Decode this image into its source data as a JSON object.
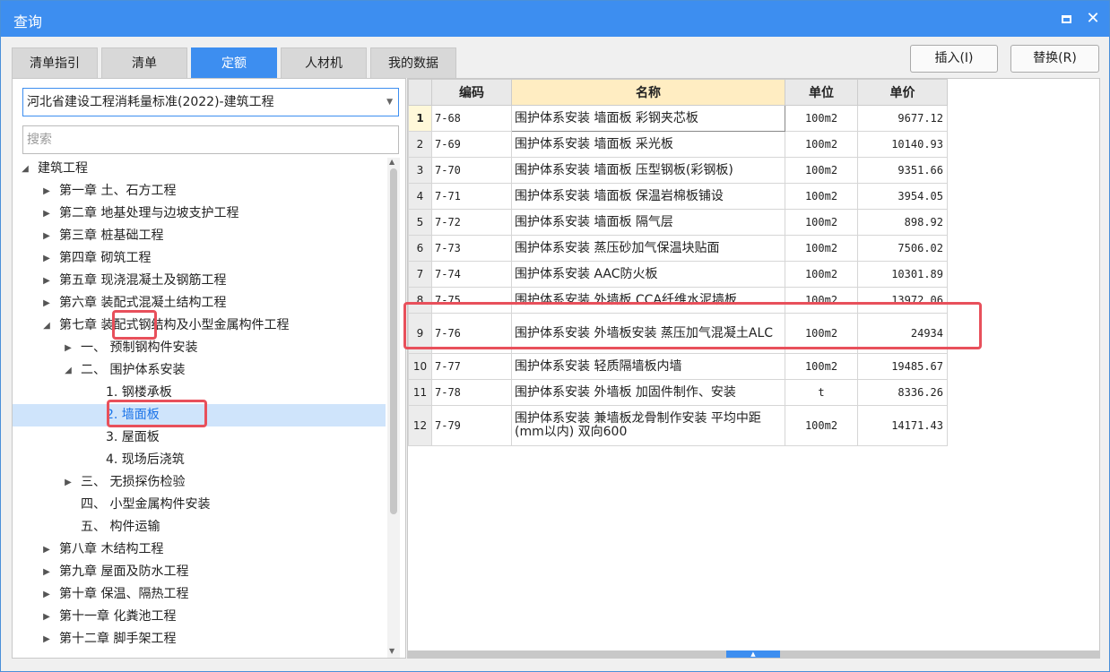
{
  "window": {
    "title": "查询"
  },
  "tabs": [
    {
      "label": "清单指引"
    },
    {
      "label": "清单"
    },
    {
      "label": "定额"
    },
    {
      "label": "人材机"
    },
    {
      "label": "我的数据"
    }
  ],
  "buttons": {
    "insert": "插入(I)",
    "replace": "替换(R)"
  },
  "left": {
    "standard": "河北省建设工程消耗量标准(2022)-建筑工程",
    "search_placeholder": "搜索",
    "tree": [
      {
        "label": "建筑工程",
        "expander": "expanded"
      },
      {
        "label": "第一章 土、石方工程",
        "expander": "collapsed"
      },
      {
        "label": "第二章 地基处理与边坡支护工程",
        "expander": "collapsed"
      },
      {
        "label": "第三章 桩基础工程",
        "expander": "collapsed"
      },
      {
        "label": "第四章 砌筑工程",
        "expander": "collapsed"
      },
      {
        "label": "第五章 现浇混凝土及钢筋工程",
        "expander": "collapsed"
      },
      {
        "label": "第六章 装配式混凝土结构工程",
        "expander": "collapsed"
      },
      {
        "label": "第七章 装配式钢结构及小型金属构件工程",
        "expander": "expanded"
      },
      {
        "label": "一、 预制钢构件安装",
        "expander": "collapsed"
      },
      {
        "label": "二、 围护体系安装",
        "expander": "expanded"
      },
      {
        "label": "1. 钢楼承板",
        "expander": "none"
      },
      {
        "label": "2. 墙面板",
        "expander": "none",
        "selected": true
      },
      {
        "label": "3. 屋面板",
        "expander": "none"
      },
      {
        "label": "4. 现场后浇筑",
        "expander": "none"
      },
      {
        "label": "三、 无损探伤检验",
        "expander": "collapsed"
      },
      {
        "label": "四、 小型金属构件安装",
        "expander": "none"
      },
      {
        "label": "五、 构件运输",
        "expander": "none"
      },
      {
        "label": "第八章 木结构工程",
        "expander": "collapsed"
      },
      {
        "label": "第九章 屋面及防水工程",
        "expander": "collapsed"
      },
      {
        "label": "第十章 保温、隔热工程",
        "expander": "collapsed"
      },
      {
        "label": "第十一章 化粪池工程",
        "expander": "collapsed"
      },
      {
        "label": "第十二章 脚手架工程",
        "expander": "collapsed"
      }
    ]
  },
  "table": {
    "headers": {
      "code": "编码",
      "name": "名称",
      "unit": "单位",
      "price": "单价"
    },
    "rows": [
      {
        "idx": "1",
        "code": "7-68",
        "name": "围护体系安装 墙面板 彩钢夹芯板",
        "unit": "100m2",
        "price": "9677.12"
      },
      {
        "idx": "2",
        "code": "7-69",
        "name": "围护体系安装 墙面板 采光板",
        "unit": "100m2",
        "price": "10140.93"
      },
      {
        "idx": "3",
        "code": "7-70",
        "name": "围护体系安装 墙面板 压型钢板(彩钢板)",
        "unit": "100m2",
        "price": "9351.66"
      },
      {
        "idx": "4",
        "code": "7-71",
        "name": "围护体系安装 墙面板 保温岩棉板铺设",
        "unit": "100m2",
        "price": "3954.05"
      },
      {
        "idx": "5",
        "code": "7-72",
        "name": "围护体系安装 墙面板 隔气层",
        "unit": "100m2",
        "price": "898.92"
      },
      {
        "idx": "6",
        "code": "7-73",
        "name": "围护体系安装 蒸压砂加气保温块贴面",
        "unit": "100m2",
        "price": "7506.02"
      },
      {
        "idx": "7",
        "code": "7-74",
        "name": "围护体系安装 AAC防火板",
        "unit": "100m2",
        "price": "10301.89"
      },
      {
        "idx": "8",
        "code": "7-75",
        "name": "围护体系安装 外墙板 CCA纤维水泥墙板",
        "unit": "100m2",
        "price": "13972.06"
      },
      {
        "idx": "9",
        "code": "7-76",
        "name": "围护体系安装 外墙板安装 蒸压加气混凝土ALC",
        "unit": "100m2",
        "price": "24934"
      },
      {
        "idx": "10",
        "code": "7-77",
        "name": "围护体系安装 轻质隔墙板内墙",
        "unit": "100m2",
        "price": "19485.67"
      },
      {
        "idx": "11",
        "code": "7-78",
        "name": "围护体系安装 外墙板 加固件制作、安装",
        "unit": "t",
        "price": "8336.26"
      },
      {
        "idx": "12",
        "code": "7-79",
        "name": "围护体系安装 兼墙板龙骨制作安装 平均中距(mm以内) 双向600",
        "unit": "100m2",
        "price": "14171.43"
      }
    ]
  },
  "colors": {
    "accent": "#3d8ef0",
    "highlight": "#e8505b"
  }
}
